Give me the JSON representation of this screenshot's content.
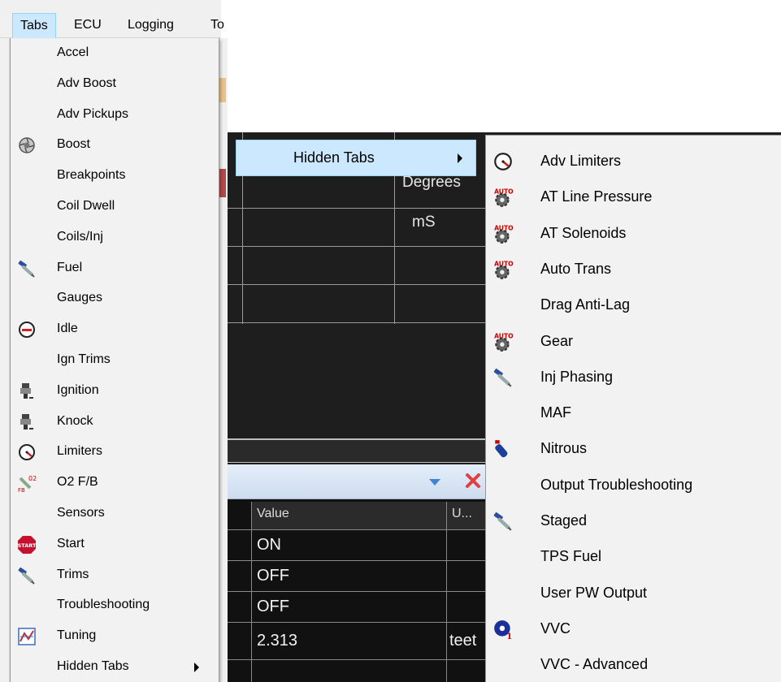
{
  "menubar": {
    "items": [
      {
        "label": "Tabs"
      },
      {
        "label": "ECU"
      },
      {
        "label": "Logging"
      },
      {
        "label": "To"
      }
    ]
  },
  "tabs_menu": {
    "items": [
      {
        "label": "Accel",
        "icon": ""
      },
      {
        "label": "Adv Boost",
        "icon": ""
      },
      {
        "label": "Adv Pickups",
        "icon": ""
      },
      {
        "label": "Boost",
        "icon": "turbo-icon"
      },
      {
        "label": "Breakpoints",
        "icon": ""
      },
      {
        "label": "Coil Dwell",
        "icon": ""
      },
      {
        "label": "Coils/Inj",
        "icon": ""
      },
      {
        "label": "Fuel",
        "icon": "injector-icon"
      },
      {
        "label": "Gauges",
        "icon": ""
      },
      {
        "label": "Idle",
        "icon": "idle-icon"
      },
      {
        "label": "Ign Trims",
        "icon": ""
      },
      {
        "label": "Ignition",
        "icon": "spark-plug-icon"
      },
      {
        "label": "Knock",
        "icon": "spark-plug-icon"
      },
      {
        "label": "Limiters",
        "icon": "gauge-icon"
      },
      {
        "label": "O2 F/B",
        "icon": "o2-feedback-icon"
      },
      {
        "label": "Sensors",
        "icon": ""
      },
      {
        "label": "Start",
        "icon": "start-icon"
      },
      {
        "label": "Trims",
        "icon": "injector-icon"
      },
      {
        "label": "Troubleshooting",
        "icon": ""
      },
      {
        "label": "Tuning",
        "icon": "tuning-chart-icon"
      },
      {
        "label": "Hidden Tabs",
        "icon": "",
        "has_submenu": true
      }
    ]
  },
  "background": {
    "grid_units": [
      "Degrees",
      "mS"
    ],
    "table": {
      "headers": [
        "Value",
        "U..."
      ],
      "rows": [
        {
          "value": "ON",
          "unit": ""
        },
        {
          "value": "OFF",
          "unit": ""
        },
        {
          "value": "OFF",
          "unit": ""
        },
        {
          "value": "2.313",
          "unit": "teet"
        }
      ]
    }
  },
  "hidden_tabs_selected": {
    "label": "Hidden Tabs"
  },
  "hidden_menu": {
    "items": [
      {
        "label": "Adv Limiters",
        "icon": "gauge-icon"
      },
      {
        "label": "AT Line Pressure",
        "icon": "auto-gear-icon"
      },
      {
        "label": "AT Solenoids",
        "icon": "auto-gear-icon"
      },
      {
        "label": "Auto Trans",
        "icon": "auto-gear-icon"
      },
      {
        "label": "Drag Anti-Lag",
        "icon": ""
      },
      {
        "label": "Gear",
        "icon": "auto-gear-icon"
      },
      {
        "label": "Inj Phasing",
        "icon": "injector-icon"
      },
      {
        "label": "MAF",
        "icon": ""
      },
      {
        "label": "Nitrous",
        "icon": "nitrous-bottle-icon"
      },
      {
        "label": "Output Troubleshooting",
        "icon": ""
      },
      {
        "label": "Staged",
        "icon": "injector-icon"
      },
      {
        "label": "TPS Fuel",
        "icon": ""
      },
      {
        "label": "User PW Output",
        "icon": ""
      },
      {
        "label": "VVC",
        "icon": "cam-icon"
      },
      {
        "label": "VVC - Advanced",
        "icon": ""
      }
    ]
  },
  "colors": {
    "menu_bg": "#f2f2f2",
    "highlight": "#cce8ff",
    "highlight_border": "#99d1ff",
    "dark_bg": "#1e1e1e"
  }
}
